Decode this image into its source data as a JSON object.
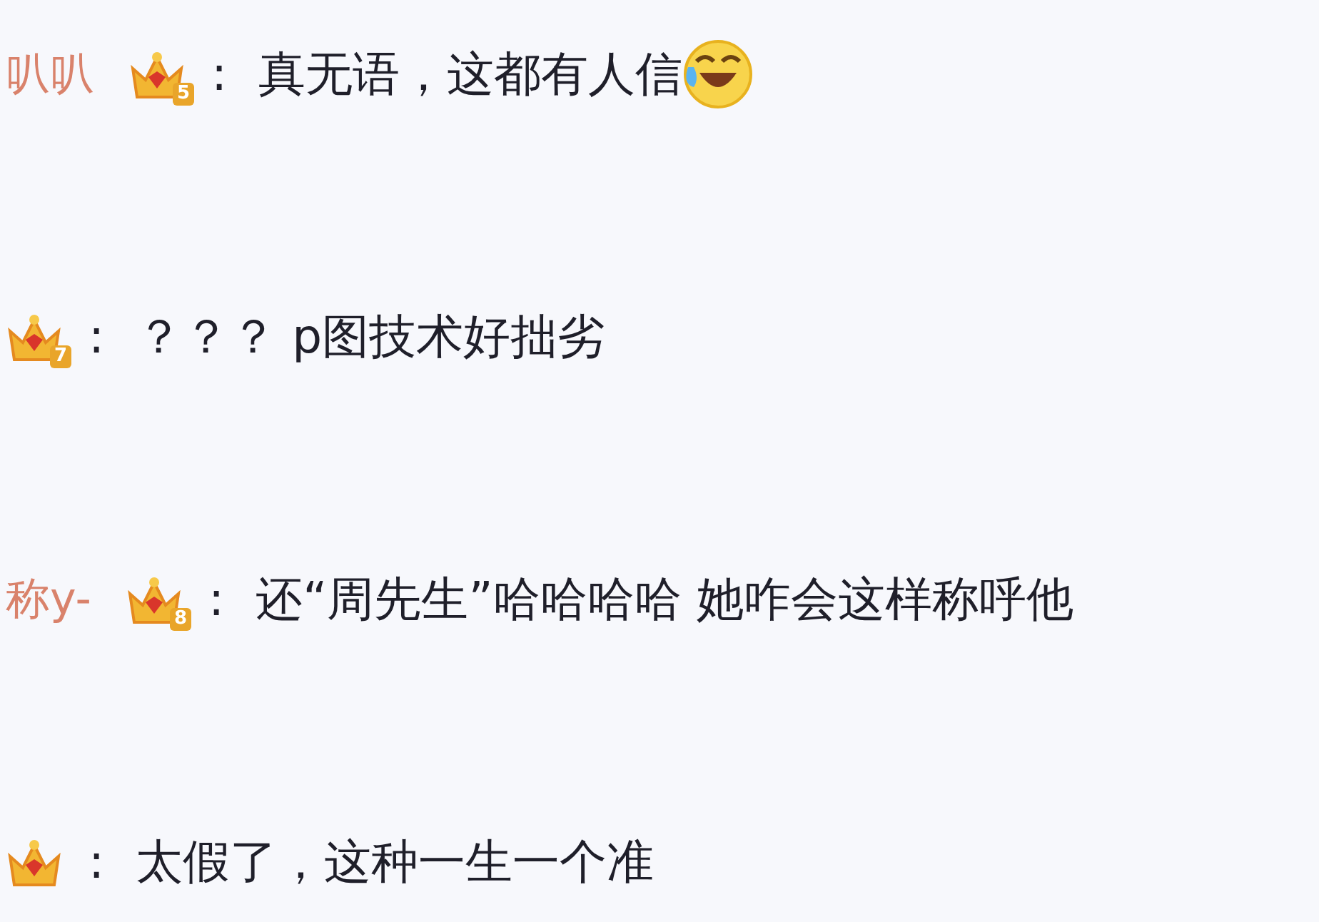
{
  "comments": [
    {
      "username": "叭叭",
      "level": "5",
      "separator": ":",
      "text": "真无语，这都有人信",
      "emoji": true
    },
    {
      "level": "7",
      "separator": ":",
      "text": "？？？ p图技术好拙劣",
      "emoji": false
    },
    {
      "username": "称y-",
      "level": "8",
      "separator": ":",
      "text": "还“周先生”哈哈哈哈 她咋会这样称呼他",
      "emoji": false
    },
    {
      "separator": ":",
      "text": "太假了，这种一生一个准",
      "emoji": false
    }
  ]
}
